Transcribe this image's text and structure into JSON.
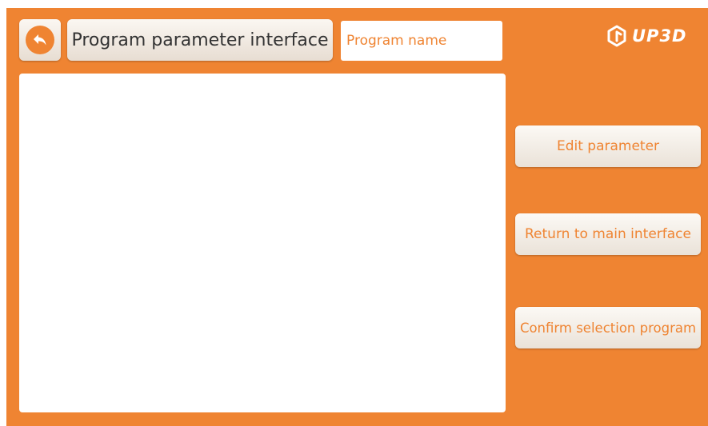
{
  "header": {
    "back_icon": "back-arrow-icon",
    "title": "Program parameter interface",
    "program_name_placeholder": "Program name",
    "logo_text": "UP3D",
    "logo_icon": "up3d-logo-icon"
  },
  "program_list": {
    "items": []
  },
  "actions": {
    "edit_label": "Edit parameter",
    "return_label": "Return to main interface",
    "confirm_label": "Confirm selection program"
  },
  "colors": {
    "accent": "#ef8432",
    "button_face": "#f5efe8",
    "panel": "#ffffff",
    "title_text": "#333333"
  }
}
